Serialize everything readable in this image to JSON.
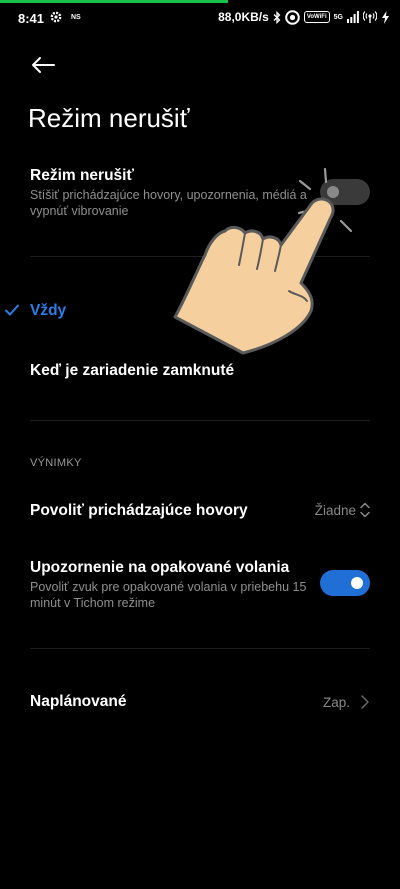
{
  "status_bar": {
    "time": "8:41",
    "ns_label": "NS",
    "speed": "88,0KB/s",
    "vowifi": "VoWiFi",
    "network": "5G"
  },
  "page": {
    "title": "Režim nerušiť"
  },
  "dnd": {
    "title": "Režim nerušiť",
    "subtitle_line1": "Stíšiť prichádzajúce hovory, upozornenia, médiá a",
    "subtitle_line2": "vypnúť vibrovanie",
    "enabled": false
  },
  "options": {
    "always": "Vždy",
    "locked": "Keď je zariadenie zamknuté",
    "selected": "always"
  },
  "exceptions": {
    "header": "VÝNIMKY",
    "calls_label": "Povoliť prichádzajúce hovory",
    "calls_value": "Žiadne",
    "repeat_title": "Upozornenie na opakované volania",
    "repeat_sub_line1": "Povoliť zvuk pre opakované volania v priebehu 15",
    "repeat_sub_line2": "minút v Tichom režime",
    "repeat_enabled": true
  },
  "scheduled": {
    "label": "Naplánované",
    "value": "Zap."
  },
  "colors": {
    "accent": "#2a7ee8",
    "toggle_on": "#1f6fd6",
    "progress": "#19c24a"
  }
}
